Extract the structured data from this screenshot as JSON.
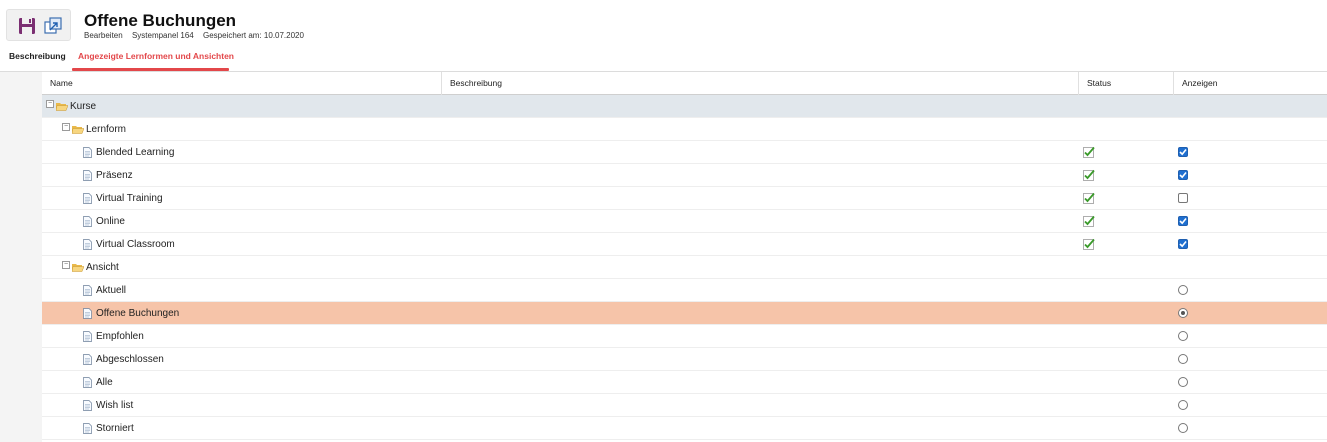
{
  "header": {
    "title": "Offene Buchungen",
    "sub": [
      "Bearbeiten",
      "Systempanel 164",
      "Gespeichert am: 10.07.2020"
    ]
  },
  "tabs": [
    {
      "label": "Beschreibung",
      "active": false
    },
    {
      "label": "Angezeigte Lernformen und Ansichten",
      "active": true
    }
  ],
  "columns": [
    "Name",
    "Beschreibung",
    "Status",
    "Anzeigen"
  ],
  "colors": {
    "accent": "#e3474a",
    "group_row": "#e1e7ec",
    "selected_row": "#f6c4a9",
    "checkbox_on": "#1f6fd0"
  },
  "rows": [
    {
      "label": "Kurse",
      "level": 0,
      "kind": "folder",
      "status": "",
      "show": ""
    },
    {
      "label": "Lernform",
      "level": 1,
      "kind": "folder",
      "status": "",
      "show": ""
    },
    {
      "label": "Blended Learning",
      "level": 2,
      "kind": "doc",
      "status": "ok",
      "show": "checked"
    },
    {
      "label": "Präsenz",
      "level": 2,
      "kind": "doc",
      "status": "ok",
      "show": "checked"
    },
    {
      "label": "Virtual Training",
      "level": 2,
      "kind": "doc",
      "status": "ok",
      "show": "unchecked"
    },
    {
      "label": "Online",
      "level": 2,
      "kind": "doc",
      "status": "ok",
      "show": "checked"
    },
    {
      "label": "Virtual Classroom",
      "level": 2,
      "kind": "doc",
      "status": "ok",
      "show": "checked"
    },
    {
      "label": "Ansicht",
      "level": 1,
      "kind": "folder",
      "status": "",
      "show": ""
    },
    {
      "label": "Aktuell",
      "level": 2,
      "kind": "doc",
      "status": "",
      "show": "radio-off"
    },
    {
      "label": "Offene Buchungen",
      "level": 2,
      "kind": "doc",
      "status": "",
      "show": "radio-on",
      "selected": true
    },
    {
      "label": "Empfohlen",
      "level": 2,
      "kind": "doc",
      "status": "",
      "show": "radio-off"
    },
    {
      "label": "Abgeschlossen",
      "level": 2,
      "kind": "doc",
      "status": "",
      "show": "radio-off"
    },
    {
      "label": "Alle",
      "level": 2,
      "kind": "doc",
      "status": "",
      "show": "radio-off"
    },
    {
      "label": "Wish list",
      "level": 2,
      "kind": "doc",
      "status": "",
      "show": "radio-off"
    },
    {
      "label": "Storniert",
      "level": 2,
      "kind": "doc",
      "status": "",
      "show": "radio-off"
    }
  ]
}
